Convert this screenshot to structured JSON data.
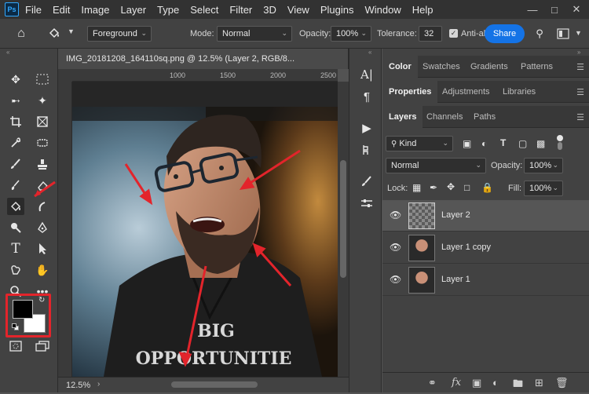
{
  "menubar": {
    "logo": "Ps",
    "items": [
      "File",
      "Edit",
      "Image",
      "Layer",
      "Type",
      "Select",
      "Filter",
      "3D",
      "View",
      "Plugins",
      "Window",
      "Help"
    ]
  },
  "options": {
    "fill_source": "Foreground",
    "mode_label": "Mode:",
    "mode_value": "Normal",
    "opacity_label": "Opacity:",
    "opacity_value": "100%",
    "tolerance_label": "Tolerance:",
    "tolerance_value": "32",
    "antialias_label": "Anti-ali",
    "share_label": "Share",
    "icons": [
      "home-icon",
      "paint-bucket-icon",
      "gear-icon",
      "search-icon",
      "workspace-icon"
    ]
  },
  "document": {
    "tab_title": "IMG_20181208_164110sq.png @ 12.5% (Layer 2, RGB/8...",
    "zoom_status": "12.5%",
    "ruler_labels": [
      "1000",
      "1500",
      "2000",
      "2500"
    ],
    "shirt_text_line1": "BIG",
    "shirt_text_line2": "OPPORTUNITIE"
  },
  "panels": {
    "row1_tabs": [
      "Color",
      "Swatches",
      "Gradients",
      "Patterns"
    ],
    "row2_tabs": [
      "Properties",
      "Adjustments",
      "Libraries"
    ],
    "row3_tabs": [
      "Layers",
      "Channels",
      "Paths"
    ],
    "filter_kind": "Kind",
    "blend_mode": "Normal",
    "opacity_label": "Opacity:",
    "opacity_value": "100%",
    "lock_label": "Lock:",
    "fill_label": "Fill:",
    "fill_value": "100%",
    "layers": [
      {
        "name": "Layer 2",
        "type": "transparent",
        "selected": true
      },
      {
        "name": "Layer 1 copy",
        "type": "photo",
        "selected": false
      },
      {
        "name": "Layer 1",
        "type": "photo",
        "selected": false
      }
    ],
    "footer_fx": "fx"
  },
  "colors": {
    "accent": "#1473e6",
    "highlight_red": "#e3242b",
    "foreground": "#000000",
    "background": "#ffffff"
  }
}
